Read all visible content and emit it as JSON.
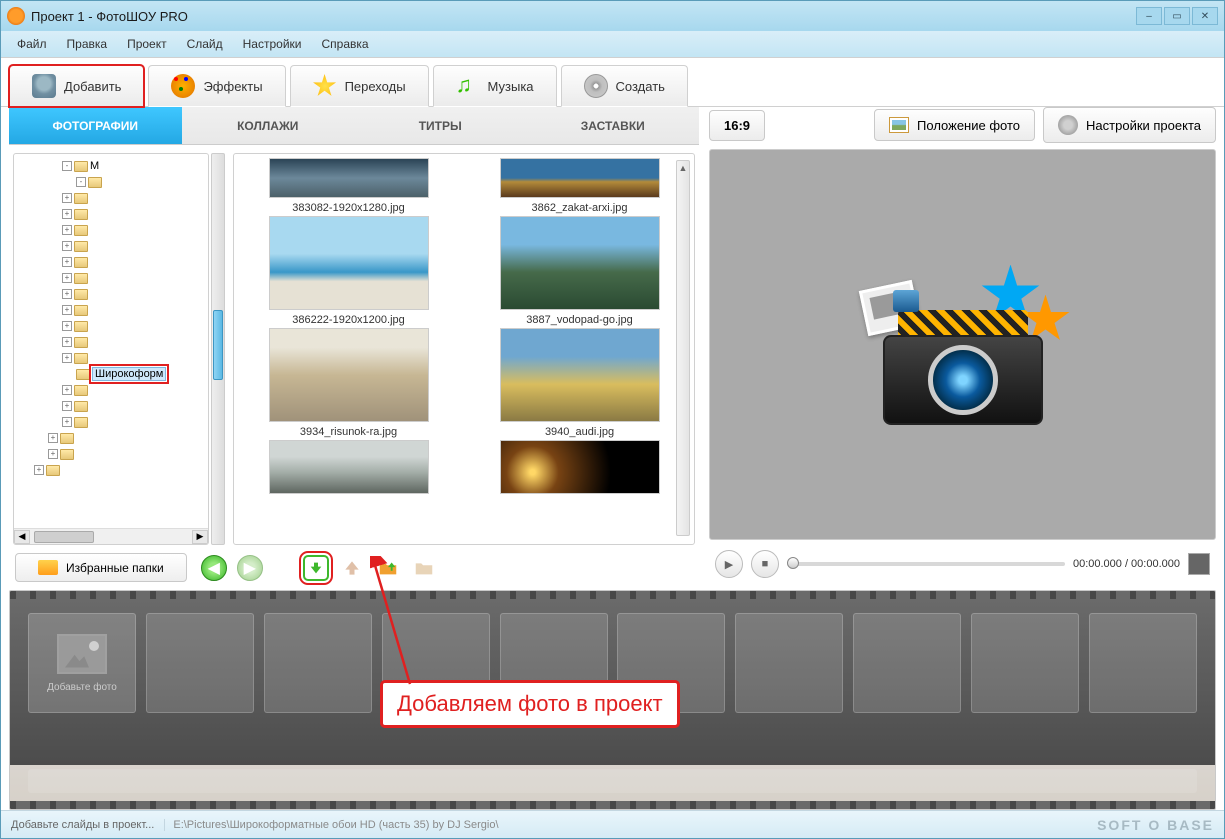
{
  "window": {
    "title": "Проект 1 - ФотоШОУ PRO"
  },
  "menu": {
    "file": "Файл",
    "edit": "Правка",
    "project": "Проект",
    "slide": "Слайд",
    "settings": "Настройки",
    "help": "Справка"
  },
  "toolbar": {
    "add": "Добавить",
    "effects": "Эффекты",
    "transitions": "Переходы",
    "music": "Музыка",
    "create": "Создать"
  },
  "subtabs": {
    "photos": "ФОТОГРАФИИ",
    "collages": "КОЛЛАЖИ",
    "titles": "ТИТРЫ",
    "intros": "ЗАСТАВКИ"
  },
  "tree": {
    "selected": "Широкоформ"
  },
  "thumbs": [
    {
      "name": "383082-1920x1280.jpg"
    },
    {
      "name": "3862_zakat-arxi.jpg"
    },
    {
      "name": "386222-1920x1200.jpg"
    },
    {
      "name": "3887_vodopad-go.jpg"
    },
    {
      "name": "3934_risunok-ra.jpg"
    },
    {
      "name": "3940_audi.jpg"
    },
    {
      "name": ""
    },
    {
      "name": ""
    }
  ],
  "favBtn": "Избранные папки",
  "right": {
    "aspect": "16:9",
    "position": "Положение фото",
    "settings": "Настройки проекта",
    "time": "00:00.000 / 00:00.000"
  },
  "timeline": {
    "addPhoto": "Добавьте фото"
  },
  "status": {
    "hint": "Добавьте слайды в проект...",
    "path": "E:\\Pictures\\Широкоформатные обои HD (часть 35) by DJ Sergio\\",
    "brand": "SOFT O BASE"
  },
  "annotation": {
    "text": "Добавляем фото в проект"
  }
}
